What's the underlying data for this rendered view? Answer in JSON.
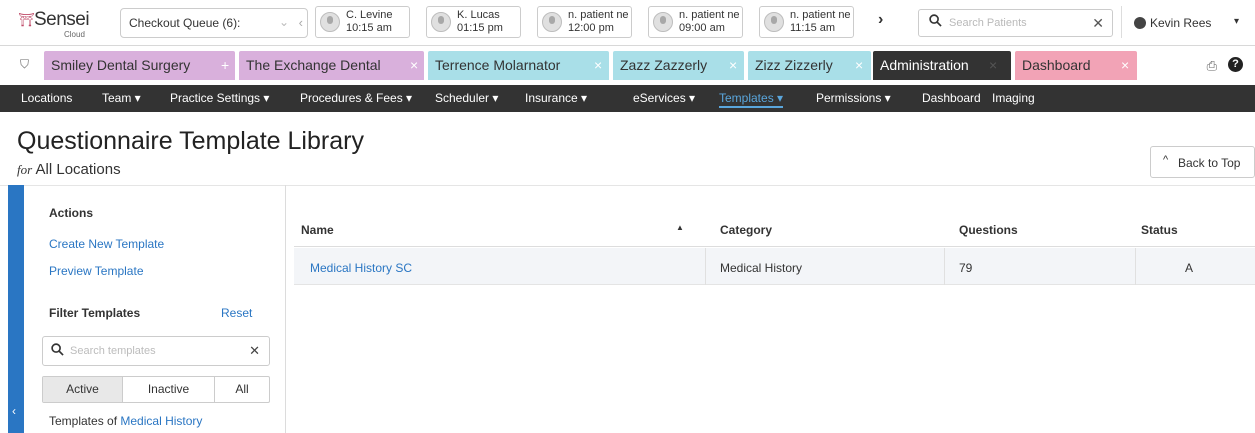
{
  "topbar": {
    "logo_text": "Sensei",
    "logo_sub": "Cloud",
    "queue_label": "Checkout Queue (6):",
    "patients": [
      {
        "name": "C. Levine",
        "time": "10:15 am"
      },
      {
        "name": "K. Lucas",
        "time": "01:15 pm"
      },
      {
        "name": "n. patient ne",
        "time": "12:00 pm"
      },
      {
        "name": "n. patient ne",
        "time": "09:00 am"
      },
      {
        "name": "n. patient ne",
        "time": "11:15 am"
      }
    ],
    "search_placeholder": "Search Patients",
    "user_name": "Kevin Rees"
  },
  "tabs": [
    {
      "label": "Smiley Dental Surgery",
      "close": "+",
      "color": "#d9b0dc"
    },
    {
      "label": "The Exchange Dental",
      "close": "×",
      "color": "#d9b0dc"
    },
    {
      "label": "Terrence Molarnator",
      "close": "×",
      "color": "#a9dfe8"
    },
    {
      "label": "Zazz Zazzerly",
      "close": "×",
      "color": "#a9dfe8"
    },
    {
      "label": "Zizz Zizzerly",
      "close": "×",
      "color": "#a9dfe8"
    },
    {
      "label": "Administration",
      "close": "×",
      "color": "#333333"
    },
    {
      "label": "Dashboard",
      "close": "×",
      "color": "#f2a3b6"
    }
  ],
  "nav": [
    {
      "label": "Locations"
    },
    {
      "label": "Team ▾"
    },
    {
      "label": "Practice Settings ▾"
    },
    {
      "label": "Procedures & Fees ▾"
    },
    {
      "label": "Scheduler ▾"
    },
    {
      "label": "Insurance ▾"
    },
    {
      "label": "eServices ▾"
    },
    {
      "label": "Templates ▾",
      "active": true
    },
    {
      "label": "Permissions ▾"
    },
    {
      "label": "Dashboard"
    },
    {
      "label": "Imaging"
    }
  ],
  "page": {
    "title": "Questionnaire Template Library",
    "sub_for": "for",
    "sub_value": "All Locations",
    "back_to_top": "Back to Top"
  },
  "sidebar": {
    "actions_heading": "Actions",
    "create_link": "Create New Template",
    "preview_link": "Preview Template",
    "filter_heading": "Filter Templates",
    "reset": "Reset",
    "search_placeholder": "Search templates",
    "segments": [
      "Active",
      "Inactive",
      "All"
    ],
    "selected_segment": "Active",
    "templates_of_label": "Templates of",
    "templates_of_value": "Medical History"
  },
  "table": {
    "headers": {
      "name": "Name",
      "category": "Category",
      "questions": "Questions",
      "status": "Status"
    },
    "rows": [
      {
        "name": "Medical History SC",
        "category": "Medical History",
        "questions": "79",
        "status": "A"
      }
    ]
  },
  "colors": {
    "accent": "#2a76c3",
    "nav_bg": "#333333",
    "nav_active": "#5aa6dc",
    "row_bg": "#f3f5f8"
  }
}
